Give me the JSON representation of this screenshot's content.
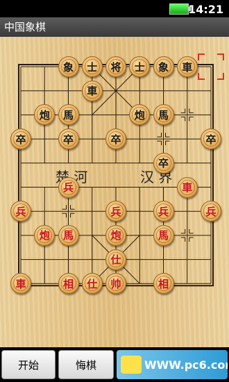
{
  "status_bar": {
    "time": "14:21"
  },
  "app": {
    "title": "中国象棋"
  },
  "river": {
    "left": "楚 河",
    "right": "汉 界"
  },
  "board": {
    "files": 9,
    "ranks": 10,
    "selected_square": {
      "col": 8,
      "row": 0
    },
    "pieces": [
      {
        "side": "black",
        "char": "象",
        "col": 2,
        "row": 0
      },
      {
        "side": "black",
        "char": "士",
        "col": 3,
        "row": 0
      },
      {
        "side": "black",
        "char": "将",
        "col": 4,
        "row": 0
      },
      {
        "side": "black",
        "char": "士",
        "col": 5,
        "row": 0
      },
      {
        "side": "black",
        "char": "象",
        "col": 6,
        "row": 0
      },
      {
        "side": "black",
        "char": "車",
        "col": 7,
        "row": 0
      },
      {
        "side": "black",
        "char": "車",
        "col": 3,
        "row": 1
      },
      {
        "side": "black",
        "char": "炮",
        "col": 1,
        "row": 2
      },
      {
        "side": "black",
        "char": "馬",
        "col": 2,
        "row": 2
      },
      {
        "side": "black",
        "char": "炮",
        "col": 5,
        "row": 2
      },
      {
        "side": "black",
        "char": "馬",
        "col": 6,
        "row": 2
      },
      {
        "side": "black",
        "char": "卒",
        "col": 0,
        "row": 3
      },
      {
        "side": "black",
        "char": "卒",
        "col": 2,
        "row": 3
      },
      {
        "side": "black",
        "char": "卒",
        "col": 4,
        "row": 3
      },
      {
        "side": "black",
        "char": "卒",
        "col": 8,
        "row": 3
      },
      {
        "side": "black",
        "char": "卒",
        "col": 6,
        "row": 4
      },
      {
        "side": "red",
        "char": "兵",
        "col": 2,
        "row": 5
      },
      {
        "side": "red",
        "char": "車",
        "col": 7,
        "row": 5
      },
      {
        "side": "red",
        "char": "兵",
        "col": 0,
        "row": 6
      },
      {
        "side": "red",
        "char": "兵",
        "col": 4,
        "row": 6
      },
      {
        "side": "red",
        "char": "兵",
        "col": 6,
        "row": 6
      },
      {
        "side": "red",
        "char": "兵",
        "col": 8,
        "row": 6
      },
      {
        "side": "red",
        "char": "炮",
        "col": 1,
        "row": 7
      },
      {
        "side": "red",
        "char": "馬",
        "col": 2,
        "row": 7
      },
      {
        "side": "red",
        "char": "炮",
        "col": 4,
        "row": 7
      },
      {
        "side": "red",
        "char": "馬",
        "col": 6,
        "row": 7
      },
      {
        "side": "red",
        "char": "仕",
        "col": 4,
        "row": 8
      },
      {
        "side": "red",
        "char": "車",
        "col": 0,
        "row": 9
      },
      {
        "side": "red",
        "char": "相",
        "col": 2,
        "row": 9
      },
      {
        "side": "red",
        "char": "仕",
        "col": 3,
        "row": 9
      },
      {
        "side": "red",
        "char": "帅",
        "col": 4,
        "row": 9
      },
      {
        "side": "red",
        "char": "相",
        "col": 6,
        "row": 9
      }
    ]
  },
  "toolbar": {
    "start_label": "开始",
    "undo_label": "悔棋",
    "watermark_text": "WWW.pc6.com"
  },
  "colors": {
    "red_side": "#c8141e",
    "black_side": "#1a1a1a",
    "highlight": "#e0301e"
  }
}
